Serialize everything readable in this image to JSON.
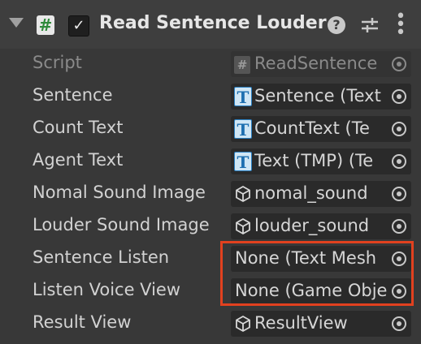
{
  "header": {
    "title": "Read Sentence Louder",
    "script_icon_glyph": "#",
    "enabled_glyph": "✓",
    "help_glyph": "?",
    "menu_glyph": "⋮"
  },
  "fields": [
    {
      "label": "Script",
      "value": "ReadSentence",
      "icon": "script-hash-icon",
      "disabled": true
    },
    {
      "label": "Sentence",
      "value": "Sentence (Text",
      "icon": "textmeshpro-icon",
      "disabled": false
    },
    {
      "label": "Count Text",
      "value": "CountText (Te",
      "icon": "textmeshpro-icon",
      "disabled": false
    },
    {
      "label": "Agent Text",
      "value": "Text (TMP) (Te",
      "icon": "textmeshpro-icon",
      "disabled": false
    },
    {
      "label": "Nomal Sound Image",
      "value": "nomal_sound",
      "icon": "gameobject-cube-icon",
      "disabled": false
    },
    {
      "label": "Louder Sound Image",
      "value": "louder_sound",
      "icon": "gameobject-cube-icon",
      "disabled": false
    },
    {
      "label": "Sentence Listen",
      "value": "None (Text Mesh",
      "icon": null,
      "disabled": false
    },
    {
      "label": "Listen Voice View",
      "value": "None (Game Obje",
      "icon": null,
      "disabled": false
    },
    {
      "label": "Result View",
      "value": "ResultView",
      "icon": "gameobject-cube-icon",
      "disabled": false
    }
  ],
  "highlight_color": "#e2411f"
}
